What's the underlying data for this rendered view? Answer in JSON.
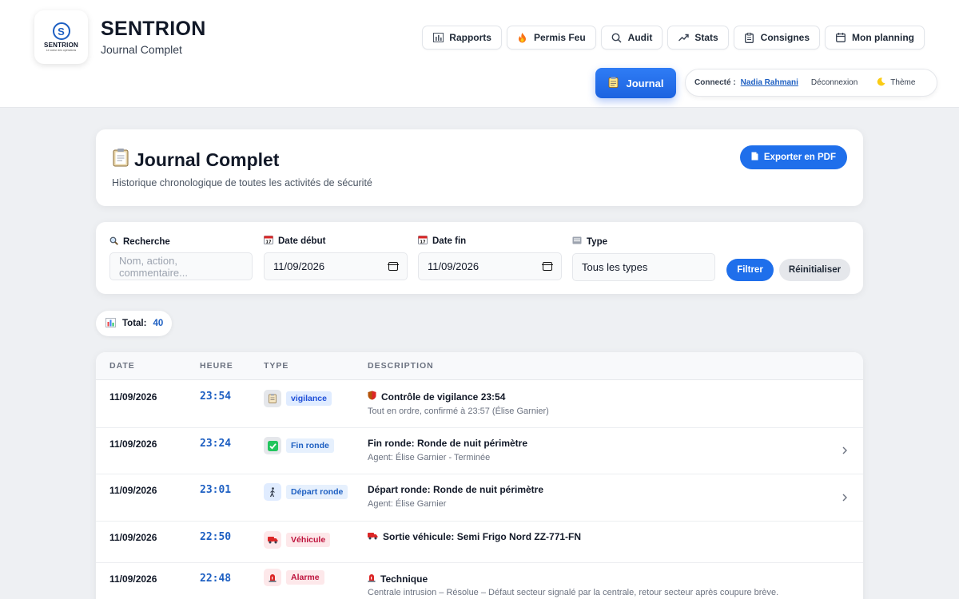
{
  "brand": {
    "logo_text": "SENTRION",
    "logo_sub": "Le coeur des opérations",
    "title": "SENTRION",
    "subtitle": "Journal Complet"
  },
  "nav": [
    {
      "label": "Rapports",
      "icon": "bar-chart-icon"
    },
    {
      "label": "Permis Feu",
      "icon": "fire-icon"
    },
    {
      "label": "Audit",
      "icon": "search-icon"
    },
    {
      "label": "Stats",
      "icon": "trend-up-icon"
    },
    {
      "label": "Consignes",
      "icon": "clipboard-icon"
    },
    {
      "label": "Mon planning",
      "icon": "calendar-icon"
    }
  ],
  "journal_button": "Journal",
  "user": {
    "connected_label": "Connecté :",
    "name": "Nadia Rahmani",
    "logout": "Déconnexion",
    "theme": "Thème"
  },
  "page": {
    "title": "Journal Complet",
    "subtitle": "Historique chronologique de toutes les activités de sécurité",
    "export_label": "Exporter en PDF"
  },
  "filters": {
    "search_label": "Recherche",
    "search_placeholder": "Nom, action, commentaire...",
    "start_label": "Date début",
    "start_value": "11/09/2026",
    "end_label": "Date fin",
    "end_value": "11/09/2026",
    "type_label": "Type",
    "type_value": "Tous les types",
    "filter_button": "Filtrer",
    "reset_button": "Réinitialiser"
  },
  "total": {
    "label": "Total:",
    "value": "40"
  },
  "table": {
    "headers": [
      "DATE",
      "HEURE",
      "TYPE",
      "DESCRIPTION"
    ],
    "rows": [
      {
        "date": "11/09/2026",
        "time": "23:54",
        "type": "vigilance",
        "type_icon": "clipboard-icon",
        "title_icon": "shield-icon",
        "title": "Contrôle de vigilance 23:54",
        "desc": "Tout en ordre, confirmé à 23:57 (Élise Garnier)",
        "expandable": false
      },
      {
        "date": "11/09/2026",
        "time": "23:24",
        "type": "Fin ronde",
        "type_icon": "check-icon",
        "title_icon": "",
        "title": "Fin ronde: Ronde de nuit périmètre",
        "desc": "Agent: Élise Garnier - Terminée",
        "expandable": true
      },
      {
        "date": "11/09/2026",
        "time": "23:01",
        "type": "Départ ronde",
        "type_icon": "walking-icon",
        "title_icon": "",
        "title": "Départ ronde: Ronde de nuit périmètre",
        "desc": "Agent: Élise Garnier",
        "expandable": true
      },
      {
        "date": "11/09/2026",
        "time": "22:50",
        "type": "Véhicule",
        "type_icon": "truck-icon",
        "title_icon": "truck-icon",
        "title": "Sortie véhicule: Semi Frigo Nord ZZ-771-FN",
        "desc": "",
        "expandable": false
      },
      {
        "date": "11/09/2026",
        "time": "22:48",
        "type": "Alarme",
        "type_icon": "alarm-icon",
        "title_icon": "alarm-icon",
        "title": "Technique",
        "desc": "Centrale intrusion – Résolue – Défaut secteur signalé par la centrale, retour secteur après coupure brève.",
        "expandable": false
      }
    ]
  },
  "colors": {
    "accent": "#1f6feb",
    "vigilance_bg": "#e0ecff",
    "fin_ronde_bg": "#e6f0fd",
    "vehicule_bg": "#fde8ea",
    "alarme_bg": "#fde8ea"
  }
}
